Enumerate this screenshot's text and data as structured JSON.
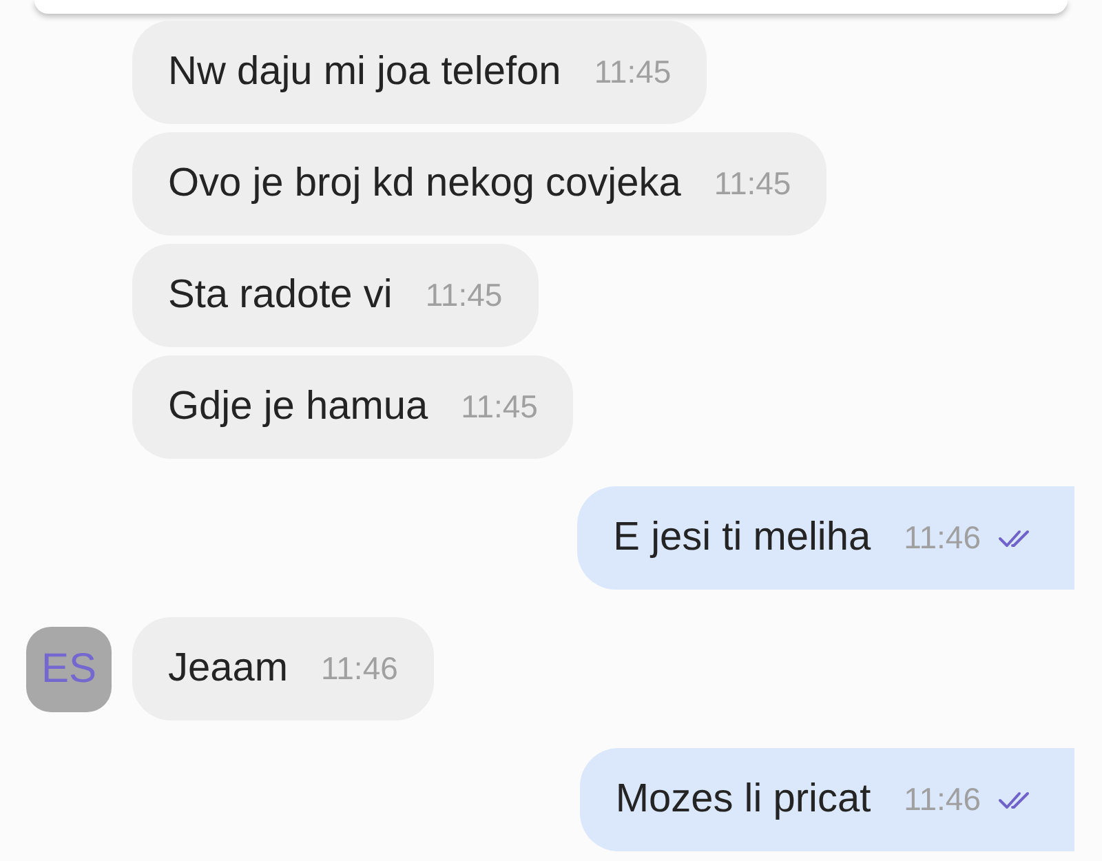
{
  "messages": [
    {
      "kind": "received",
      "text": "Nw daju mi joa telefon",
      "time": "11:45"
    },
    {
      "kind": "received",
      "text": "Ovo je broj kd nekog covjeka",
      "time": "11:45"
    },
    {
      "kind": "received",
      "text": "Sta radote vi",
      "time": "11:45"
    },
    {
      "kind": "received",
      "text": "Gdje je hamua",
      "time": "11:45"
    },
    {
      "kind": "sent",
      "text": "E jesi ti meliha",
      "time": "11:46",
      "read": true
    },
    {
      "kind": "received",
      "text": "Jeaam",
      "time": "11:46",
      "avatar": "ES"
    },
    {
      "kind": "sent",
      "text": "Mozes li pricat",
      "time": "11:46",
      "read": true
    }
  ]
}
